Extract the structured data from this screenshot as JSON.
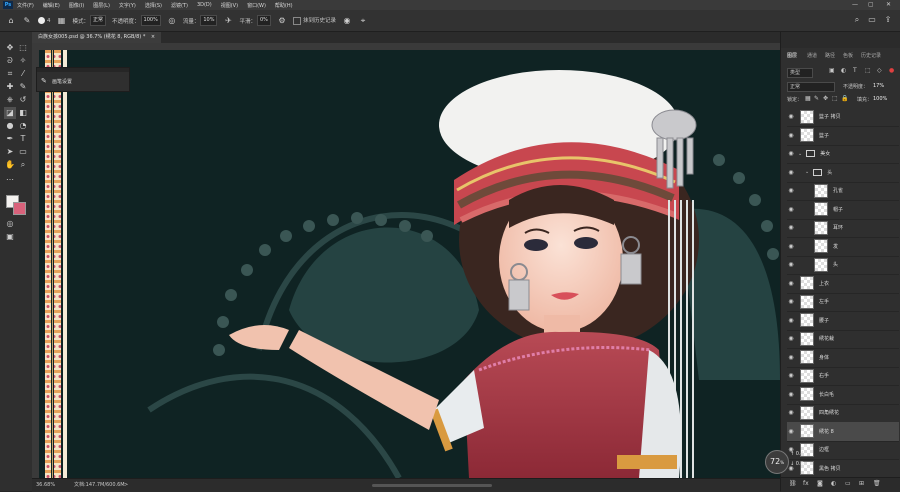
{
  "menubar": {
    "logo": "Ps",
    "items": [
      "文件(F)",
      "编辑(E)",
      "图像(I)",
      "图层(L)",
      "文字(Y)",
      "选择(S)",
      "滤镜(T)",
      "3D(D)",
      "视图(V)",
      "窗口(W)",
      "帮助(H)"
    ],
    "win_min": "—",
    "win_max": "▢",
    "win_close": "✕"
  },
  "options": {
    "brush_size": "4",
    "mode_label": "模式：",
    "mode_value": "正常",
    "opacity_label": "不透明度：",
    "opacity_value": "100%",
    "flow_label": "流量：",
    "flow_value": "10%",
    "smooth_label": "平滑：",
    "smooth_value": "0%",
    "history_label": "抹到历史记录"
  },
  "document": {
    "tab_title": "白族女孩005.psd @ 36.7% (绣花 8, RGB/8) *",
    "tab_close": "×"
  },
  "brush_panel": {
    "title": "画笔设置"
  },
  "statusbar": {
    "zoom": "36.68%",
    "doc_info": "文档:147.7M/600.6M",
    "arrow": ">"
  },
  "panels": {
    "tabs": [
      "图层",
      "通道",
      "路径",
      "色板",
      "历史记录"
    ],
    "filter_label": "类型",
    "blend_mode": "正常",
    "opacity_label": "不透明度：",
    "opacity_value": "17%",
    "lock_label": "锁定：",
    "fill_label": "填充：",
    "fill_value": "100%",
    "layers": [
      {
        "name": "篮子 拷贝",
        "indent": 0,
        "type": "layer"
      },
      {
        "name": "篮子",
        "indent": 0,
        "type": "layer"
      },
      {
        "name": "美女",
        "indent": 0,
        "type": "folder"
      },
      {
        "name": "头",
        "indent": 1,
        "type": "folder"
      },
      {
        "name": "孔雀",
        "indent": 2,
        "type": "layer"
      },
      {
        "name": "帽子",
        "indent": 2,
        "type": "layer"
      },
      {
        "name": "耳环",
        "indent": 2,
        "type": "layer"
      },
      {
        "name": "发",
        "indent": 2,
        "type": "layer"
      },
      {
        "name": "头",
        "indent": 2,
        "type": "layer"
      },
      {
        "name": "上衣",
        "indent": 0,
        "type": "layer"
      },
      {
        "name": "左手",
        "indent": 0,
        "type": "layer"
      },
      {
        "name": "腰子",
        "indent": 0,
        "type": "layer"
      },
      {
        "name": "绣花裁",
        "indent": 0,
        "type": "layer"
      },
      {
        "name": "身体",
        "indent": 0,
        "type": "layer"
      },
      {
        "name": "右手",
        "indent": 0,
        "type": "layer"
      },
      {
        "name": "长白毛",
        "indent": 0,
        "type": "layer"
      },
      {
        "name": "四角绣花",
        "indent": 0,
        "type": "layer"
      },
      {
        "name": "绣花 8",
        "indent": 0,
        "type": "layer",
        "selected": true
      },
      {
        "name": "边框",
        "indent": 0,
        "type": "layer"
      },
      {
        "name": "黑色 拷贝",
        "indent": 0,
        "type": "layer"
      }
    ]
  },
  "perf_widget": {
    "value": "72",
    "unit": "%",
    "up": "0.4",
    "down": "0.6"
  }
}
